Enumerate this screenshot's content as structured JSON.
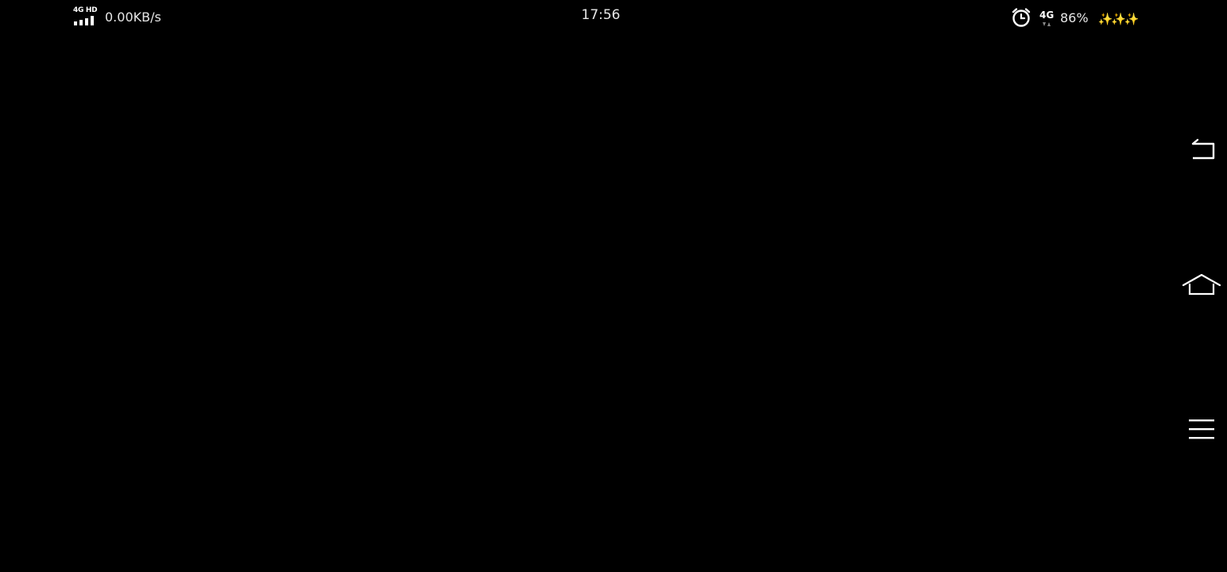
{
  "status_bar": {
    "network_type": "4G HD",
    "network_speed": "0.00KB/s",
    "time": "17:56",
    "data_network": "4G",
    "battery_percent": "86%",
    "signal_bars": 4
  },
  "nav_bar": {
    "buttons": [
      {
        "name": "back",
        "icon": "back-arrow-icon"
      },
      {
        "name": "home",
        "icon": "home-icon"
      },
      {
        "name": "menu",
        "icon": "menu-icon"
      }
    ]
  },
  "colors": {
    "background": "#000000",
    "status_text": "#e6e6e6",
    "icon": "#ffffff",
    "sparkle": "#ffd84a"
  }
}
